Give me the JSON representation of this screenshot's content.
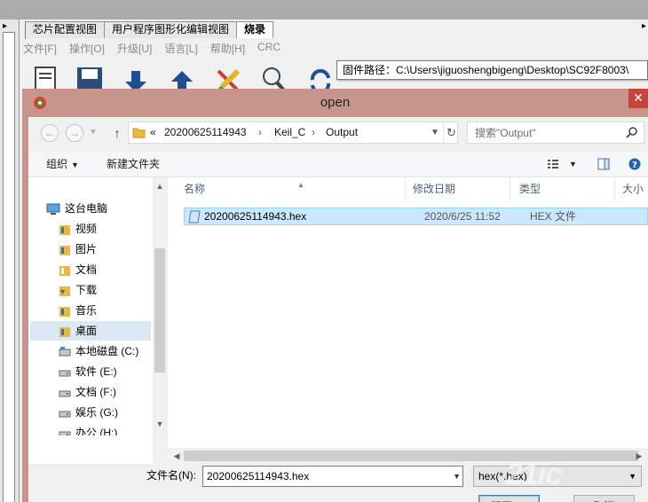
{
  "background_app": {
    "tabs": [
      {
        "label": "芯片配置视图",
        "active": false
      },
      {
        "label": "用户程序图形化编辑视图",
        "active": false
      },
      {
        "label": "烧录",
        "active": true
      }
    ],
    "menu": [
      "文件[F]",
      "操作[O]",
      "升级[U]",
      "语言[L]",
      "帮助[H]",
      "CRC"
    ],
    "tooltip": "固件路径：C:\\Users\\jiguoshengbigeng\\Desktop\\SC92F8003\\"
  },
  "dialog": {
    "title": "open",
    "close_label": "✕",
    "nav": {
      "back": "←",
      "forward": "→",
      "up": "↑"
    },
    "address": {
      "overflow": "«",
      "crumbs": [
        "20200625114943",
        "Keil_C",
        "Output"
      ],
      "separator": "›"
    },
    "search": {
      "placeholder": "搜索\"Output\""
    },
    "commands": {
      "organize": "组织",
      "new_folder": "新建文件夹"
    },
    "nav_tree": [
      {
        "label": "这台电脑",
        "icon": "computer-icon"
      },
      {
        "label": "视频",
        "icon": "folder-icon"
      },
      {
        "label": "图片",
        "icon": "folder-icon"
      },
      {
        "label": "文档",
        "icon": "folder-icon"
      },
      {
        "label": "下载",
        "icon": "download-folder-icon"
      },
      {
        "label": "音乐",
        "icon": "folder-icon"
      },
      {
        "label": "桌面",
        "icon": "folder-icon"
      },
      {
        "label": "本地磁盘 (C:)",
        "icon": "drive-icon"
      },
      {
        "label": "软件 (E:)",
        "icon": "drive-icon"
      },
      {
        "label": "文档 (F:)",
        "icon": "drive-icon"
      },
      {
        "label": "娱乐 (G:)",
        "icon": "drive-icon"
      },
      {
        "label": "办公 (H:)",
        "icon": "drive-icon"
      }
    ],
    "columns": [
      "名称",
      "修改日期",
      "类型",
      "大小"
    ],
    "files": [
      {
        "name": "20200625114943.hex",
        "date": "2020/6/25 11:52",
        "type": "HEX 文件"
      }
    ],
    "filename_label": "文件名(N):",
    "filename_value": "20200625114943.hex",
    "filter_value": "hex(*.hex)",
    "open_button": "打开(O)",
    "cancel_button": "取消"
  },
  "watermark": "21ic",
  "colors": {
    "dialog_frame": "#c8958c",
    "close_button": "#c7443c",
    "selection": "#cce8ff"
  }
}
